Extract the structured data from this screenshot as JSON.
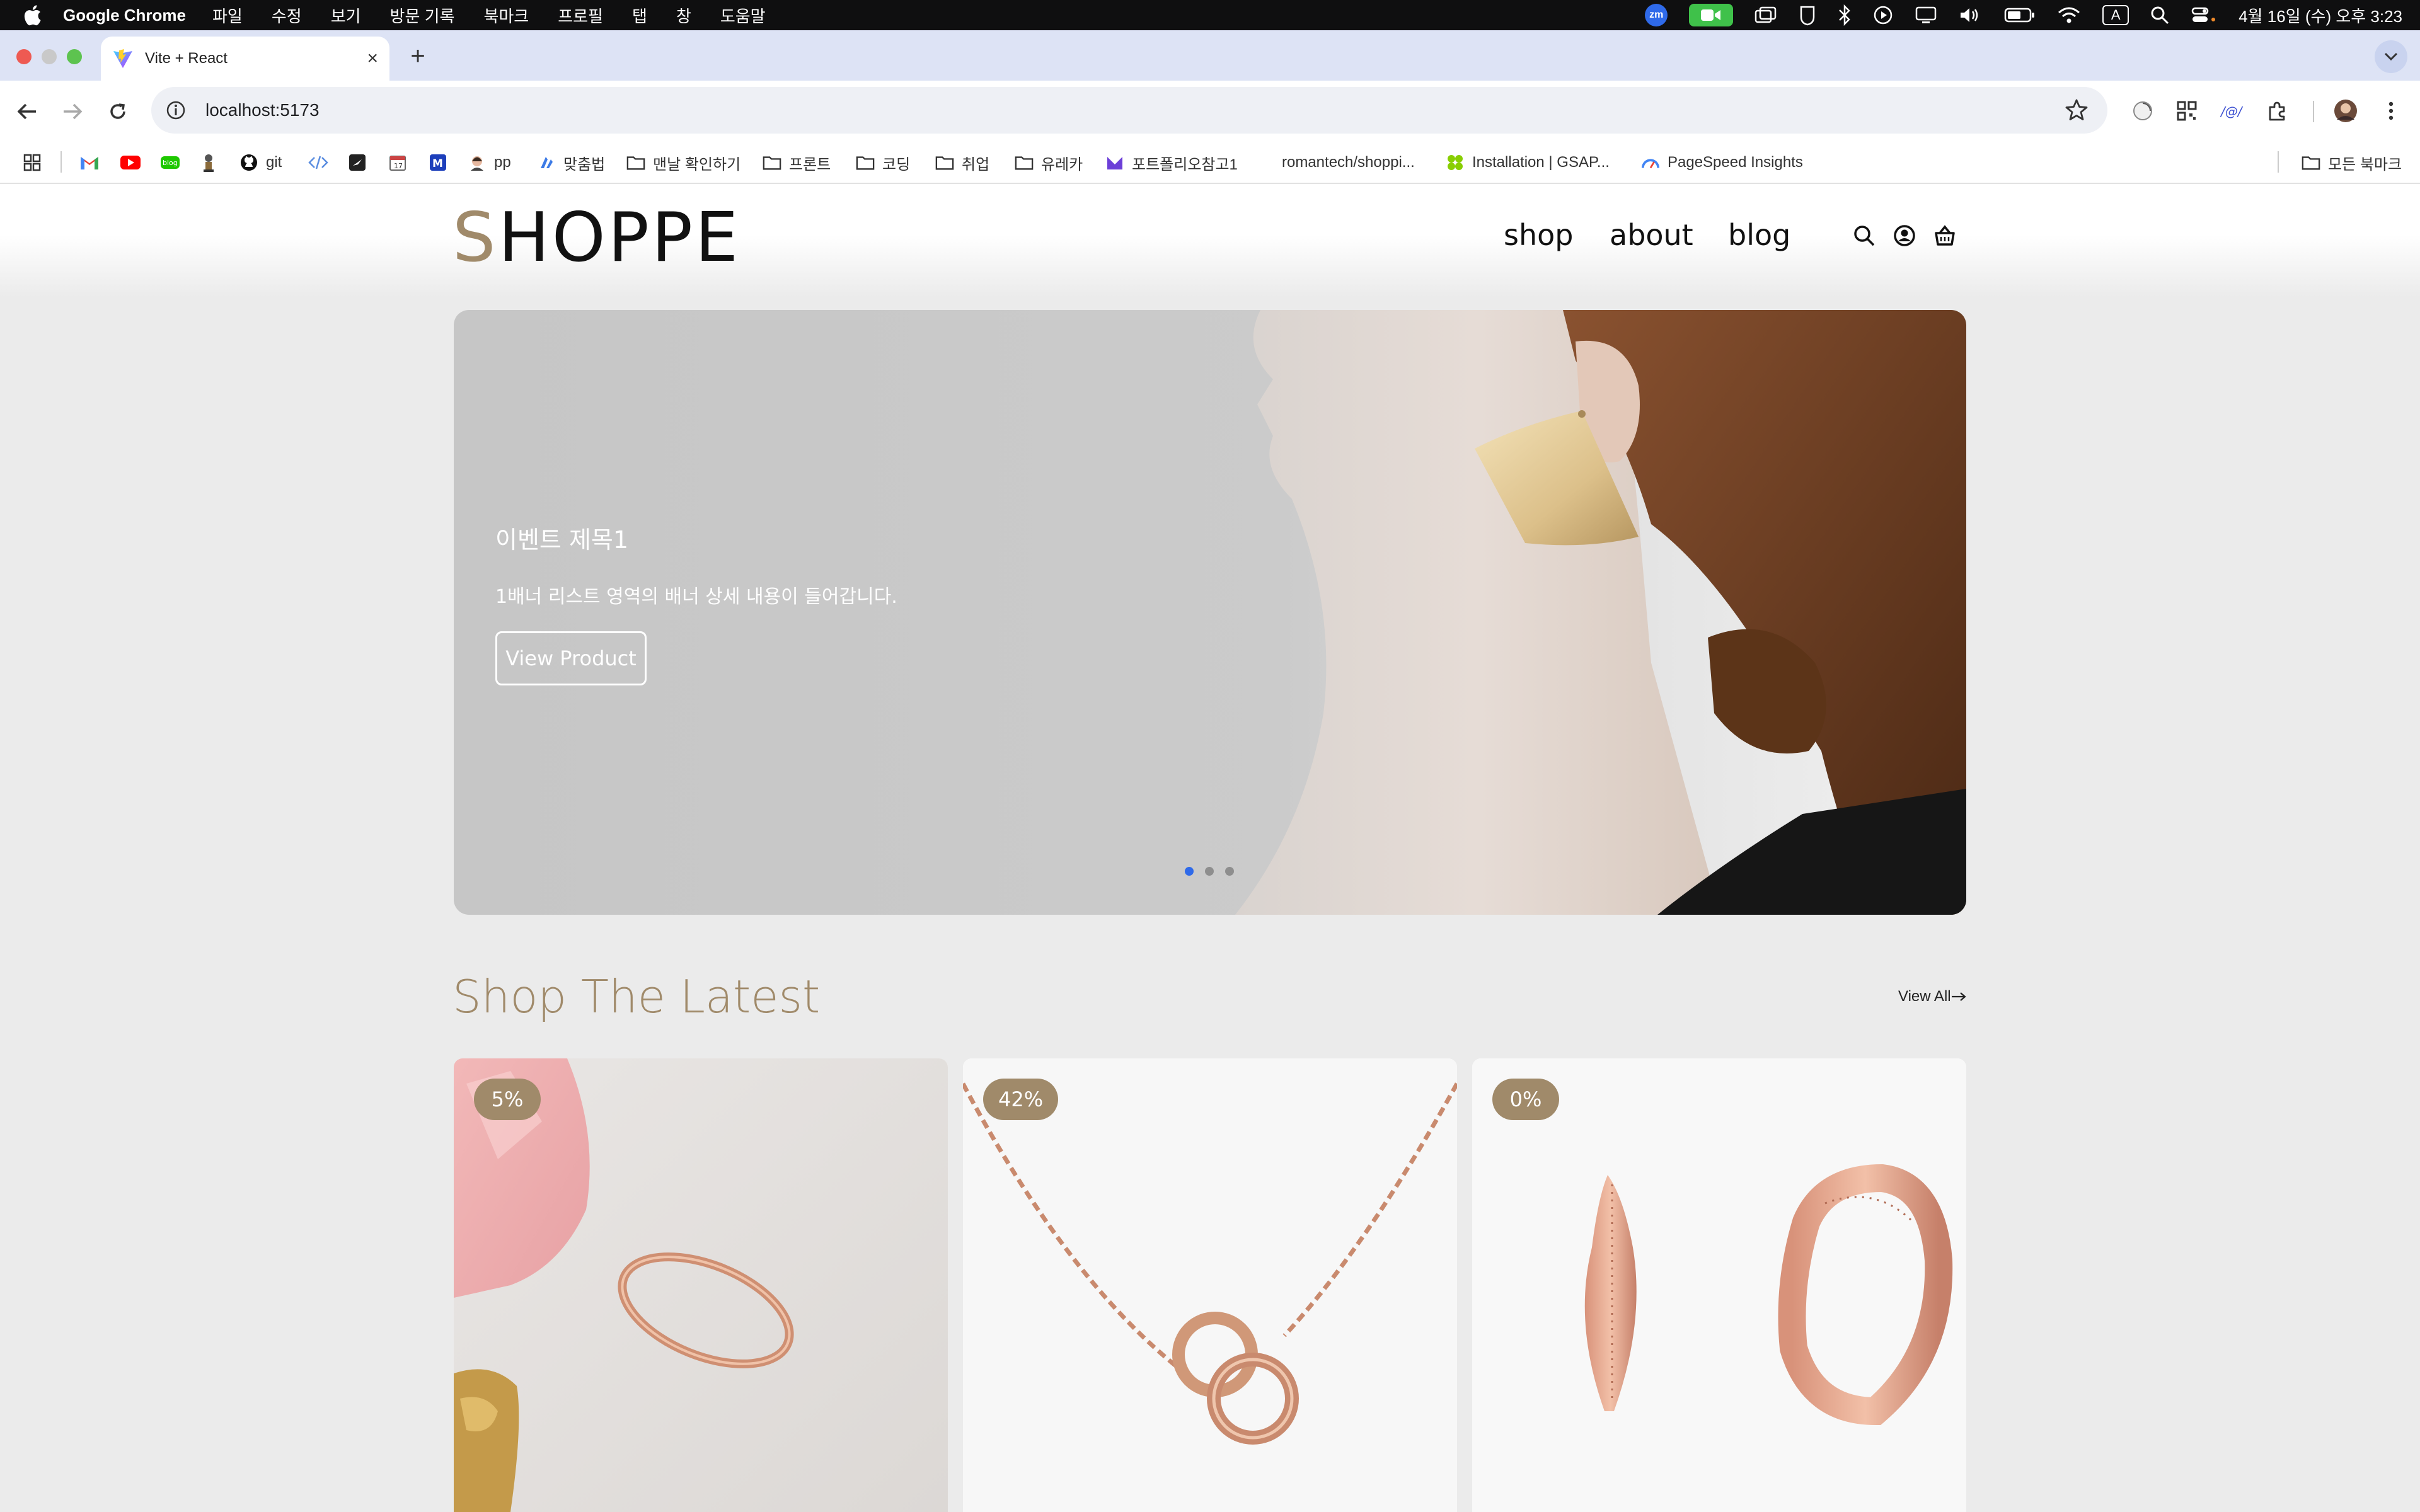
{
  "menubar": {
    "app_name": "Google Chrome",
    "items": [
      "파일",
      "수정",
      "보기",
      "방문 기록",
      "북마크",
      "프로필",
      "탭",
      "창",
      "도움말"
    ],
    "zoom_label": "zm",
    "input_source": "A",
    "datetime": "4월 16일 (수) 오후 3:23"
  },
  "browser": {
    "tab_title": "Vite + React",
    "url": "localhost:5173",
    "bookmarks": {
      "git": "git",
      "pp": "pp",
      "spelling": "맞춤법",
      "folder1": "맨날 확인하기",
      "folder2": "프론트",
      "folder3": "코딩",
      "folder4": "취업",
      "folder5": "유레카",
      "portfolio": "포트폴리오참고1",
      "romantech": "romantech/shoppi...",
      "gsap": "Installation | GSAP...",
      "pagespeed": "PageSpeed Insights",
      "all_bookmarks": "모든 북마크"
    }
  },
  "site": {
    "logo_first": "S",
    "logo_rest": "HOPPE",
    "nav": [
      "shop",
      "about",
      "blog"
    ],
    "banner": {
      "title": "이벤트 제목1",
      "description": "1배너 리스트 영역의 배너 상세 내용이 들어갑니다.",
      "button": "View Product",
      "slide_count": 3,
      "active_slide": 1
    },
    "latest": {
      "title": "Shop The Latest",
      "view_all": "View All"
    },
    "products": [
      {
        "discount": "5%"
      },
      {
        "discount": "42%"
      },
      {
        "discount": "0%"
      }
    ]
  },
  "colors": {
    "brand_accent": "#a08a6a",
    "active_dot": "#2f6ae9",
    "page_bg": "#ebebeb"
  }
}
